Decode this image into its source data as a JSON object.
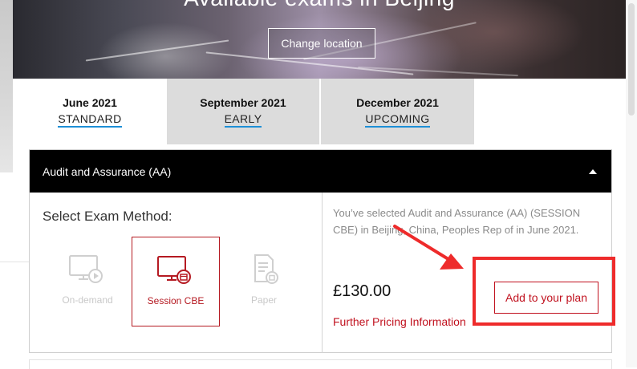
{
  "hero": {
    "title": "Available exams in Beijing",
    "change_location_label": "Change location"
  },
  "tabs": [
    {
      "month": "June 2021",
      "status": "STANDARD",
      "active": true
    },
    {
      "month": "September 2021",
      "status": "EARLY",
      "active": false
    },
    {
      "month": "December 2021",
      "status": "UPCOMING",
      "active": false
    }
  ],
  "exam": {
    "title": "Audit and Assurance (AA)",
    "method_label": "Select Exam Method:",
    "methods": [
      {
        "label": "On-demand",
        "icon": "monitor-play-icon",
        "selected": false
      },
      {
        "label": "Session CBE",
        "icon": "monitor-calendar-icon",
        "selected": true
      },
      {
        "label": "Paper",
        "icon": "paper-exam-icon",
        "selected": false
      }
    ],
    "selection_text": "You’ve selected Audit and Assurance (AA) (SESSION CBE) in Beijing, China, Peoples Rep of in June 2021.",
    "price": "£130.00",
    "add_button_label": "Add to your plan",
    "pricing_link_label": "Further Pricing Information"
  },
  "colors": {
    "accent_red": "#c1121f",
    "tab_underline": "#1d8fd6",
    "header_black": "#000000",
    "annotation_red": "#ee2b2b"
  }
}
